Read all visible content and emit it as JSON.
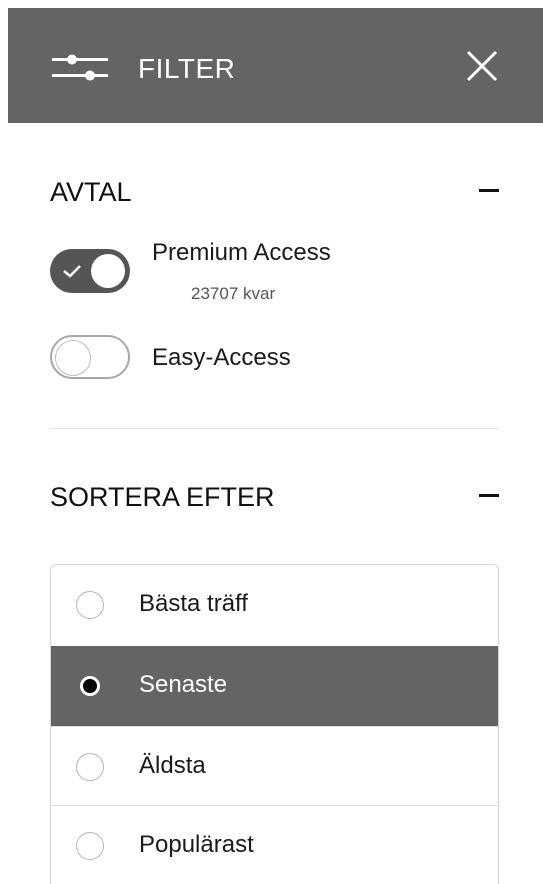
{
  "header": {
    "title": "FILTER",
    "icon": "filter-sliders-icon",
    "close_icon": "close-icon",
    "background": "#646464"
  },
  "avtal": {
    "title": "AVTAL",
    "collapse_icon": "minus-icon",
    "toggles": [
      {
        "label": "Premium Access",
        "sublabel": "23707 kvar",
        "on": true
      },
      {
        "label": "Easy-Access",
        "on": false
      }
    ]
  },
  "sort": {
    "title": "SORTERA EFTER",
    "collapse_icon": "minus-icon",
    "options": [
      {
        "label": "Bästa träff",
        "selected": false
      },
      {
        "label": "Senaste",
        "selected": true
      },
      {
        "label": "Äldsta",
        "selected": false
      },
      {
        "label": "Populärast",
        "selected": false
      }
    ],
    "selected_background": "#646464"
  }
}
